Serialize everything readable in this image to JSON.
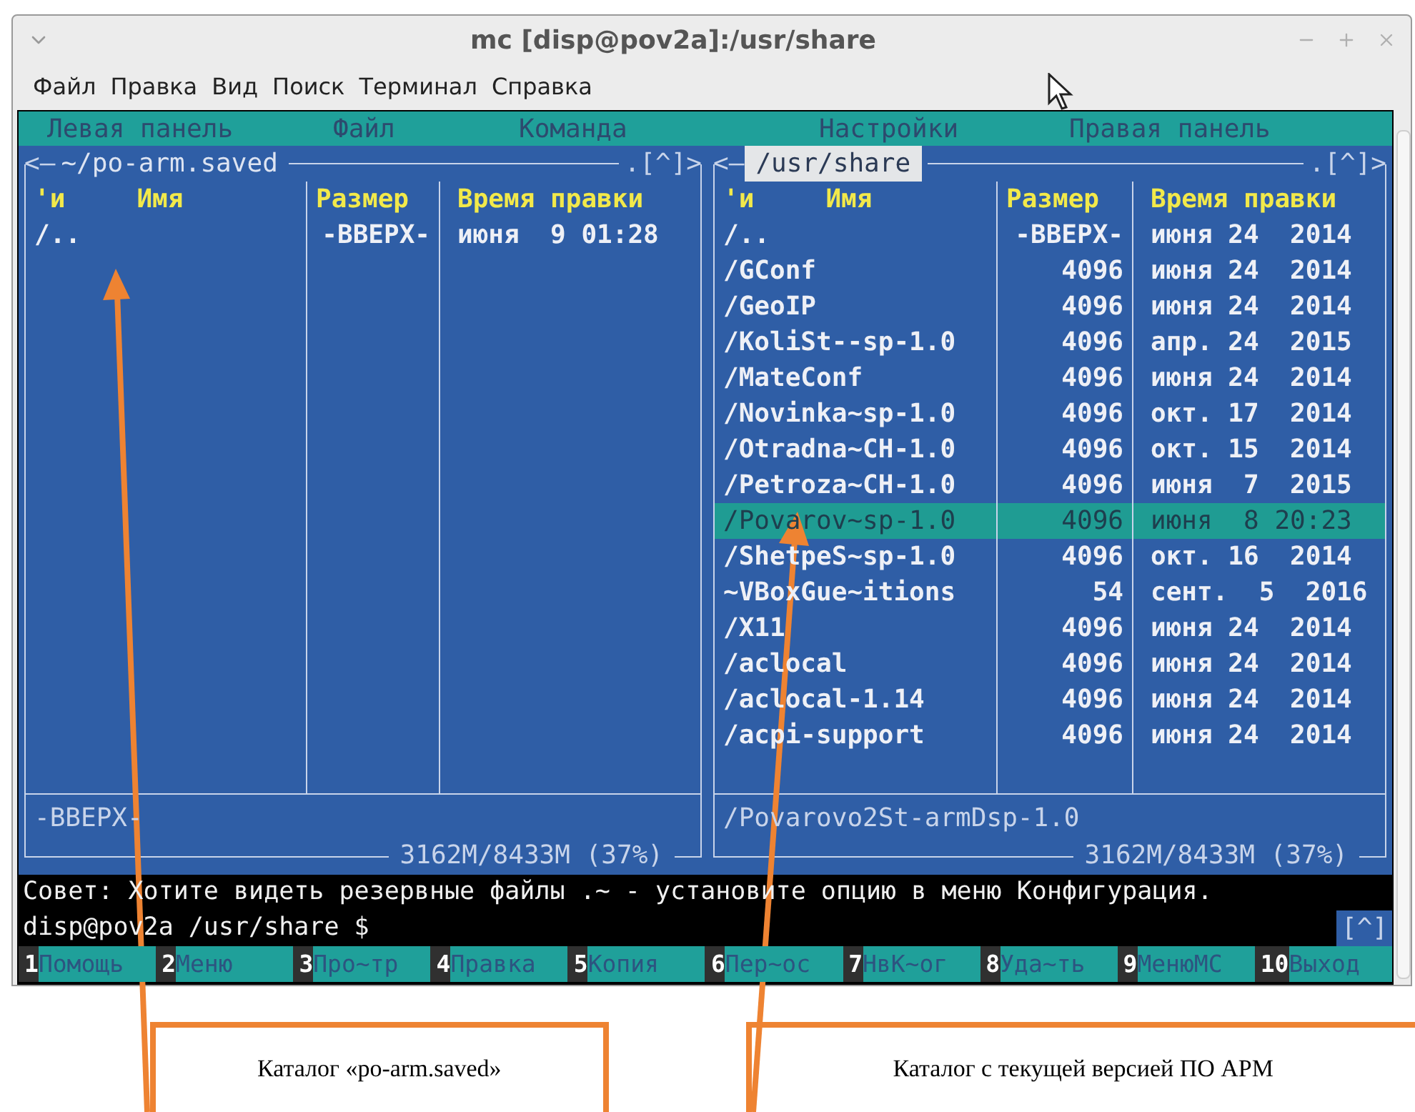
{
  "window": {
    "title": "mc [disp@pov2a]:/usr/share"
  },
  "menu": [
    "Файл",
    "Правка",
    "Вид",
    "Поиск",
    "Терминал",
    "Справка"
  ],
  "mc_menu": [
    "Левая панель",
    "Файл",
    "Команда",
    "Настройки",
    "Правая панель"
  ],
  "panels": [
    {
      "left_marker": "<–",
      "path": "~/po-arm.saved",
      "right_marker": ".[^]>",
      "active": false,
      "columns": [
        "'и",
        "Имя",
        "Размер",
        "Время правки"
      ],
      "rows": [
        {
          "name": "/..",
          "size": "-ВВЕРХ-",
          "time": "июня  9 01:28",
          "selected": false
        }
      ],
      "status": "-ВВЕРХ-",
      "disk": "3162M/8433M (37%)"
    },
    {
      "left_marker": "<–",
      "path": "/usr/share",
      "right_marker": ".[^]>",
      "active": true,
      "columns": [
        "'и",
        "Имя",
        "Размер",
        "Время правки"
      ],
      "rows": [
        {
          "name": "/..",
          "size": "-ВВЕРХ-",
          "time": "июня 24  2014",
          "selected": false
        },
        {
          "name": "/GConf",
          "size": "4096",
          "time": "июня 24  2014",
          "selected": false
        },
        {
          "name": "/GeoIP",
          "size": "4096",
          "time": "июня 24  2014",
          "selected": false
        },
        {
          "name": "/KoliSt--sp-1.0",
          "size": "4096",
          "time": "апр. 24  2015",
          "selected": false
        },
        {
          "name": "/MateConf",
          "size": "4096",
          "time": "июня 24  2014",
          "selected": false
        },
        {
          "name": "/Novinka~sp-1.0",
          "size": "4096",
          "time": "окт. 17  2014",
          "selected": false
        },
        {
          "name": "/Otradna~CH-1.0",
          "size": "4096",
          "time": "окт. 15  2014",
          "selected": false
        },
        {
          "name": "/Petroza~CH-1.0",
          "size": "4096",
          "time": "июня  7  2015",
          "selected": false
        },
        {
          "name": "/Povarov~sp-1.0",
          "size": "4096",
          "time": "июня  8 20:23",
          "selected": true
        },
        {
          "name": "/ShetpeS~sp-1.0",
          "size": "4096",
          "time": "окт. 16  2014",
          "selected": false
        },
        {
          "name": "~VBoxGue~itions",
          "size": "54",
          "time": "сент.  5  2016",
          "selected": false
        },
        {
          "name": "/X11",
          "size": "4096",
          "time": "июня 24  2014",
          "selected": false
        },
        {
          "name": "/aclocal",
          "size": "4096",
          "time": "июня 24  2014",
          "selected": false
        },
        {
          "name": "/aclocal-1.14",
          "size": "4096",
          "time": "июня 24  2014",
          "selected": false
        },
        {
          "name": "/acpi-support",
          "size": "4096",
          "time": "июня 24  2014",
          "selected": false
        }
      ],
      "status": "/Povarovo2St-armDsp-1.0",
      "disk": "3162M/8433M (37%)"
    }
  ],
  "hint": "Совет: Хотите видеть резервные файлы .~ - установите опцию в меню Конфигурация.",
  "prompt": "disp@pov2a /usr/share $",
  "prompt_marker": "[^]",
  "fkeys": [
    {
      "num": "1",
      "label": "Помощь"
    },
    {
      "num": "2",
      "label": "Меню"
    },
    {
      "num": "3",
      "label": "Про~тр"
    },
    {
      "num": "4",
      "label": "Правка"
    },
    {
      "num": "5",
      "label": "Копия"
    },
    {
      "num": "6",
      "label": "Пер~ос"
    },
    {
      "num": "7",
      "label": "НвК~ог"
    },
    {
      "num": "8",
      "label": "Уда~ть"
    },
    {
      "num": "9",
      "label": "МенюMC"
    },
    {
      "num": "10",
      "label": "Выход"
    }
  ],
  "annotations": [
    {
      "text": "Каталог «po-arm.saved»"
    },
    {
      "text": "Каталог с текущей версией ПО АРМ"
    }
  ]
}
